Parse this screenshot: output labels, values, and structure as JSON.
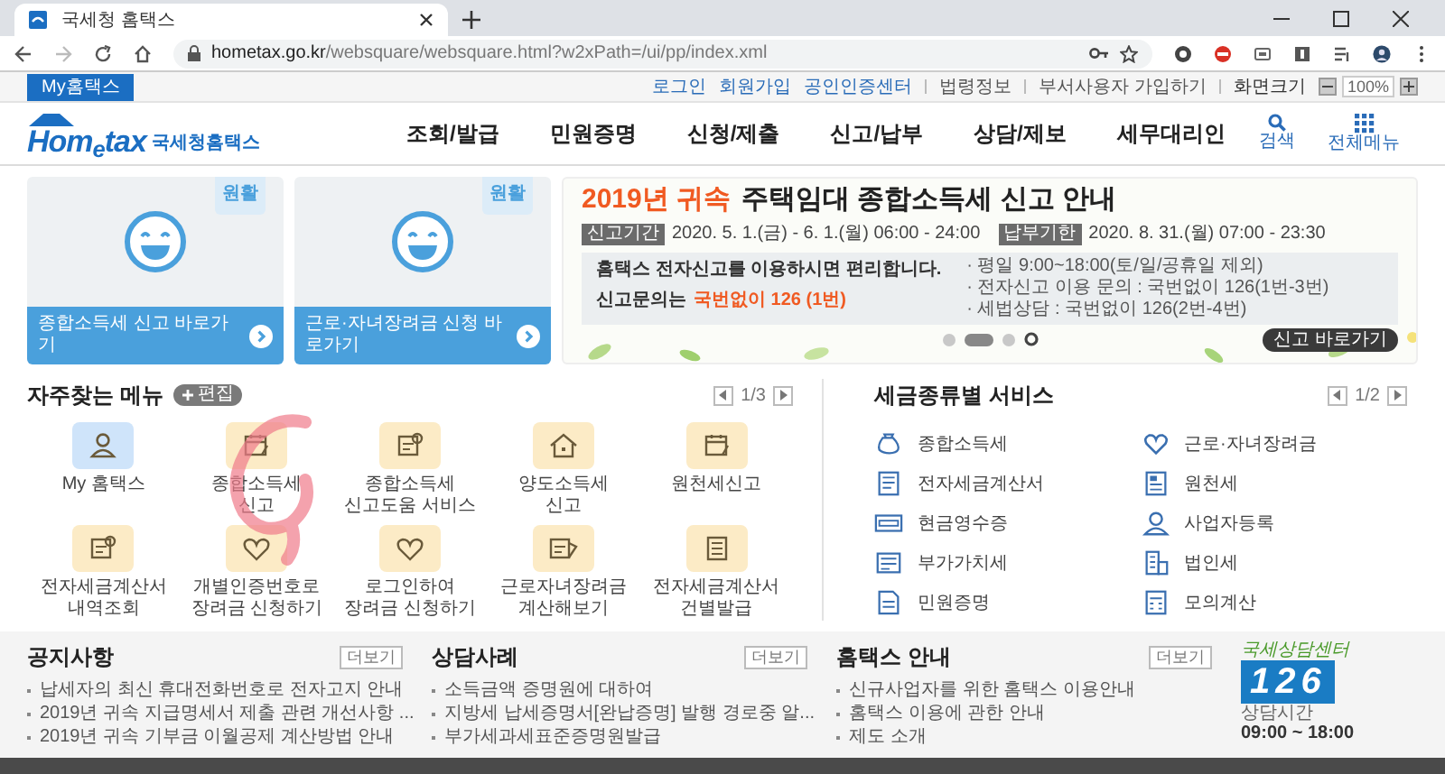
{
  "browser": {
    "tab_title": "국세청 홈택스",
    "url_host": "hometax.go.kr",
    "url_path": "/websquare/websquare.html?w2xPath=/ui/pp/index.xml"
  },
  "utility_bar": {
    "my_tab": "My홈택스",
    "links": [
      {
        "label": "로그인",
        "kind": "primary"
      },
      {
        "label": "회원가입",
        "kind": "primary"
      },
      {
        "label": "공인인증센터",
        "kind": "primary"
      },
      {
        "label": "법령정보",
        "kind": "secondary"
      },
      {
        "label": "부서사용자 가입하기",
        "kind": "secondary"
      }
    ],
    "screen_size": {
      "label": "화면크기",
      "value": "100%"
    }
  },
  "header": {
    "logo": {
      "wordmark": "Hom$_{e}$tax",
      "name": "국세청홈택스"
    },
    "nav": [
      "조회/발급",
      "민원증명",
      "신청/제출",
      "신고/납부",
      "상담/제보",
      "세무대리인"
    ],
    "search": "검색",
    "all_menu": "전체메뉴"
  },
  "quick_cards": [
    {
      "badge": "원활",
      "label": "종합소득세 신고 바로가기"
    },
    {
      "badge": "원활",
      "label": "근로·자녀장려금 신청 바로가기"
    }
  ],
  "banner": {
    "title_highlight": "2019년 귀속",
    "title": "주택임대 종합소득세 신고 안내",
    "periods": [
      {
        "tag": "신고기간",
        "text": "2020. 5. 1.(금) - 6. 1.(월) 06:00 - 24:00"
      },
      {
        "tag": "납부기한",
        "text": "2020. 8. 31.(월) 07:00 - 23:30"
      }
    ],
    "info": {
      "lead": "홈택스 전자신고를 이용하시면 편리합니다.",
      "contact_label": "신고문의는",
      "contact_number": "국번없이 126 (1번)",
      "notes": [
        "· 평일 9:00~18:00(토/일/공휴일 제외)",
        "· 전자신고 이용 문의 : 국번없이 126(1번-3번)",
        "· 세법상담 : 국번없이 126(2번-4번)"
      ]
    },
    "slides": [
      {
        "selected": false
      },
      {
        "selected": true
      },
      {
        "selected": false
      }
    ],
    "button": "신고 바로가기"
  },
  "favorites": {
    "title": "자주찾는 메뉴",
    "edit_button": "편집",
    "page": "1/3",
    "items": [
      {
        "label": "My 홈택스",
        "kind": "account"
      },
      {
        "label": "종합소득세\n신고",
        "kind": "service"
      },
      {
        "label": "종합소득세\n신고도움 서비스",
        "kind": "service"
      },
      {
        "label": "양도소득세\n신고",
        "kind": "service"
      },
      {
        "label": "원천세신고",
        "kind": "service"
      },
      {
        "label": "전자세금계산서\n내역조회",
        "kind": "service"
      },
      {
        "label": "개별인증번호로\n장려금 신청하기",
        "kind": "service"
      },
      {
        "label": "로그인하여\n장려금 신청하기",
        "kind": "service"
      },
      {
        "label": "근로자녀장려금\n계산해보기",
        "kind": "service"
      },
      {
        "label": "전자세금계산서\n건별발급",
        "kind": "service"
      }
    ]
  },
  "tax_services": {
    "title": "세금종류별 서비스",
    "page": "1/2",
    "items": [
      "종합소득세",
      "근로·자녀장려금",
      "전자세금계산서",
      "원천세",
      "현금영수증",
      "사업자등록",
      "부가가치세",
      "법인세",
      "민원증명",
      "모의계산"
    ]
  },
  "footer": {
    "columns": [
      {
        "title": "공지사항",
        "more": "더보기",
        "items": [
          "납세자의 최신 휴대전화번호로 전자고지 안내",
          "2019년 귀속 지급명세서 제출 관련 개선사항 ...",
          "2019년 귀속 기부금 이월공제 계산방법 안내"
        ]
      },
      {
        "title": "상담사례",
        "more": "더보기",
        "items": [
          "소득금액 증명원에 대하여",
          "지방세 납세증명서[완납증명] 발행 경로중 알...",
          "부가세과세표준증명원발급"
        ]
      },
      {
        "title": "홈택스 안내",
        "more": "더보기",
        "items": [
          "신규사업자를 위한 홈택스 이용안내",
          "홈택스 이용에 관한 안내",
          "제도 소개"
        ]
      }
    ],
    "call_center": {
      "caption": "국세상담센터",
      "number": "126",
      "hours_label": "상담시간",
      "hours": "09:00 ~ 18:00"
    }
  }
}
